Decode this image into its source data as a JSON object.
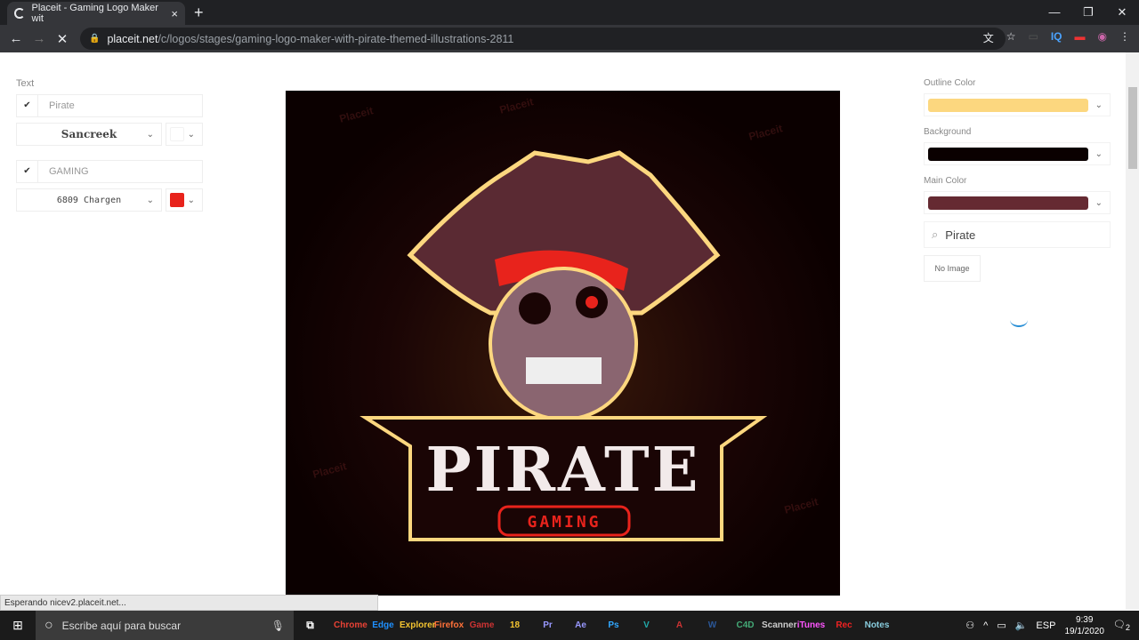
{
  "browser": {
    "tab_title": "Placeit - Gaming Logo Maker wit",
    "url_host": "placeit.net",
    "url_path": "/c/logos/stages/gaming-logo-maker-with-pirate-themed-illustrations-2811",
    "status_text": "Esperando nicev2.placeit.net..."
  },
  "left_panel": {
    "section_label": "Text",
    "lines": [
      {
        "text": "Pirate",
        "font": "Sancreek",
        "color": "#ffffff"
      },
      {
        "text": "GAMING",
        "font": "6809 Chargen",
        "color": "#e8231c"
      }
    ]
  },
  "canvas": {
    "title": "PIRATE",
    "subtitle": "GAMING",
    "watermark": "Placeit"
  },
  "right_panel": {
    "colors": [
      {
        "label": "Outline Color",
        "value": "#fcd77f"
      },
      {
        "label": "Background",
        "value": "#0a0000"
      },
      {
        "label": "Main Color",
        "value": "#652a32"
      }
    ],
    "search_value": "Pirate",
    "no_image_label": "No Image"
  },
  "taskbar": {
    "search_placeholder": "Escribe aquí para buscar",
    "apps": [
      "Chrome",
      "Edge",
      "Explorer",
      "Firefox",
      "Game",
      "18",
      "Pr",
      "Ae",
      "Ps",
      "V",
      "A",
      "W",
      "C4D",
      "Scanner",
      "iTunes",
      "Rec",
      "Notes"
    ],
    "language": "ESP",
    "time": "9:39",
    "date": "19/1/2020",
    "notifications": "2"
  }
}
